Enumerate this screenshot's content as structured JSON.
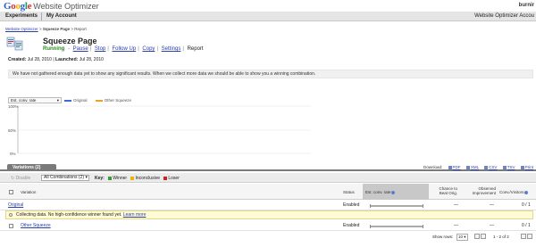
{
  "header": {
    "logo_google": "Google",
    "logo_product": "Website Optimizer",
    "user": "burnir"
  },
  "nav": {
    "experiments": "Experiments",
    "my_account": "My Account",
    "account_label": "Website Optimizer Accou"
  },
  "breadcrumb": {
    "home": "Website Optimizer",
    "sep1": " > ",
    "experiment": "Squeeze Page",
    "sep2": " > ",
    "current": "Report"
  },
  "experiment": {
    "title": "Squeeze Page",
    "status": "Running",
    "actions": [
      "Pause",
      "Stop",
      "Follow Up",
      "Copy",
      "Settings",
      "Report"
    ],
    "created_label": "Created:",
    "created": "Jul 28, 2010",
    "launched_label": "Launched:",
    "launched": "Jul 28, 2010"
  },
  "notice": "We have not gathered enough data yet to show any significant results. When we collect more data we should be able to show you a winning combination.",
  "chart_controls": {
    "metric_select": "Est. conv. rate",
    "legend": [
      {
        "name": "Original",
        "color": "#3a6ed0"
      },
      {
        "name": "Other Squeeze",
        "color": "#f0a020"
      }
    ]
  },
  "chart_data": {
    "type": "line",
    "yticks": [
      "100%",
      "50%",
      "0%"
    ],
    "ylim": [
      0,
      100
    ],
    "series": [
      {
        "name": "Original",
        "values": []
      },
      {
        "name": "Other Squeeze",
        "values": []
      }
    ],
    "grid": true
  },
  "tabs": {
    "variations": "Variations (2)"
  },
  "downloads": {
    "label": "Download:",
    "formats": [
      "PDF",
      "XML",
      "CSV",
      "TSV",
      "Print"
    ]
  },
  "toolbar": {
    "disable": "Disable",
    "combo_select": "All Combinations (2)",
    "key_label": "Key:",
    "key_items": [
      {
        "label": "Winner",
        "color": "#3a9a3a"
      },
      {
        "label": "Inconclusive",
        "color": "#e6b800"
      },
      {
        "label": "Loser",
        "color": "#cc2222"
      }
    ]
  },
  "table": {
    "headers": {
      "variation": "Variation",
      "status": "Status",
      "ecr": "Est. conv. rate",
      "chance_line1": "Chance to",
      "chance_line2": "Beat Orig.",
      "observed_line1": "Observed",
      "observed_line2": "Improvement",
      "conv": "Conv./Visitors"
    },
    "rows": [
      {
        "name": "Original",
        "status": "Enabled",
        "chance": "—",
        "observed": "—",
        "conv": "0 / 1"
      },
      {
        "name": "Other Squeeze",
        "status": "Enabled",
        "chance": "—",
        "observed": "—",
        "conv": "0 / 1"
      }
    ],
    "collecting": "Collecting data.  No high-confidence winner found yet.",
    "learn_more": "Learn more"
  },
  "footer": {
    "show_rows_label": "Show rows:",
    "show_rows_value": "10",
    "range": "1 - 2 of 2"
  }
}
